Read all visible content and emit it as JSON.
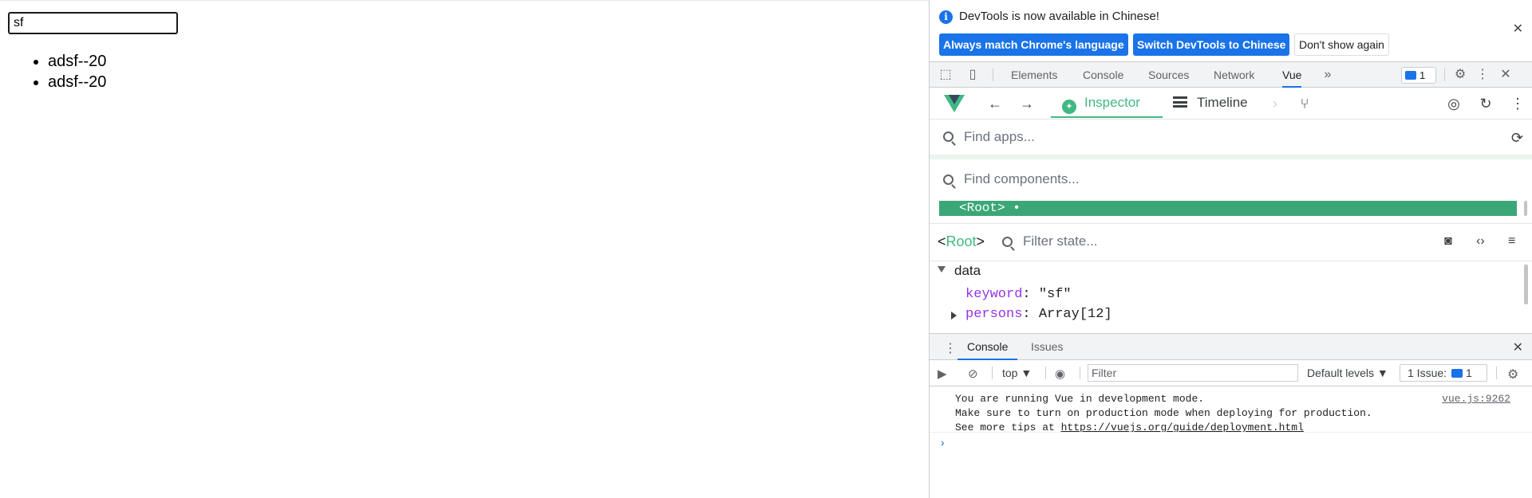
{
  "page": {
    "search_value": "sf",
    "results": [
      "adsf--20",
      "adsf--20"
    ]
  },
  "infobar": {
    "message": "DevTools is now available in Chinese!",
    "btn_match": "Always match Chrome's language",
    "btn_switch": "Switch DevTools to Chinese",
    "btn_dont": "Don't show again"
  },
  "devtools_tabs": {
    "elements": "Elements",
    "console": "Console",
    "sources": "Sources",
    "network": "Network",
    "vue": "Vue",
    "issues_count": "1"
  },
  "vue": {
    "inspector": "Inspector",
    "timeline": "Timeline",
    "find_apps_placeholder": "Find apps...",
    "find_components_placeholder": "Find components...",
    "root_node": "<Root>",
    "root_dot": "•",
    "state_root_open": "<",
    "state_root_name": "Root",
    "state_root_close": ">",
    "filter_state_placeholder": "Filter state...",
    "data_label": "data",
    "keyword_key": "keyword",
    "keyword_value": ": \"sf\"",
    "persons_key": "persons",
    "persons_value": ": Array[12]"
  },
  "drawer": {
    "console_tab": "Console",
    "issues_tab": "Issues",
    "context": "top ▼",
    "filter_placeholder": "Filter",
    "levels": "Default levels ▼",
    "issues_label": "1 Issue:",
    "issues_count": "1"
  },
  "console": {
    "line1": "You are running Vue in development mode.",
    "line2": "Make sure to turn on production mode when deploying for production.",
    "line3_prefix": "See more tips at ",
    "line3_url": "https://vuejs.org/guide/deployment.html",
    "source": "vue.js:9262",
    "prompt": "›"
  },
  "colors": {
    "vue_green": "#41b883",
    "root_highlight": "#3ba776",
    "chrome_blue": "#1a73e8"
  }
}
